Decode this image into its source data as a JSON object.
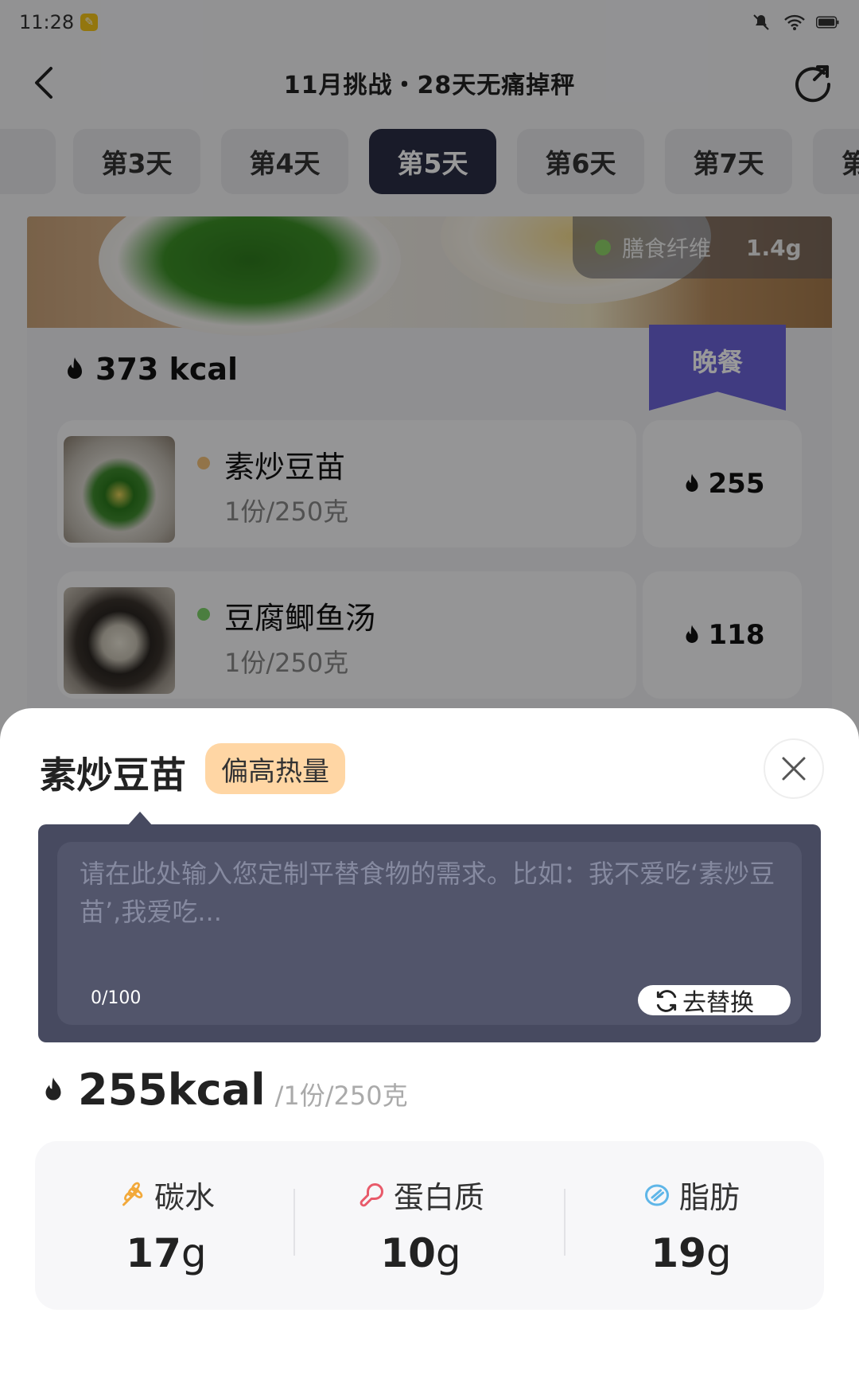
{
  "status_bar": {
    "time": "11:28"
  },
  "nav": {
    "title": "11月挑战・28天无痛掉秤"
  },
  "day_tabs": [
    "第3天",
    "第4天",
    "第5天",
    "第6天",
    "第7天",
    "第"
  ],
  "active_tab": "第5天",
  "meal": {
    "fiber_label": "膳食纤维",
    "fiber_value": "1.4g",
    "total_kcal": "373 kcal",
    "meal_label": "晚餐",
    "items": [
      {
        "name": "素炒豆苗",
        "portion": "1份/250克",
        "kcal": "255",
        "dot_color": "#f4c27a"
      },
      {
        "name": "豆腐鲫鱼汤",
        "portion": "1份/250克",
        "kcal": "118",
        "dot_color": "#7ed36a"
      }
    ]
  },
  "sheet": {
    "title": "素炒豆苗",
    "badge": "偏高热量",
    "input_placeholder": "请在此处输入您定制平替食物的需求。比如：我不爱吃‘素炒豆苗’,我爱吃...",
    "input_value": "",
    "char_count": "0/100",
    "replace_label": "去替换",
    "kcal": "255kcal",
    "portion": "/1份/250克",
    "macros": [
      {
        "label": "碳水",
        "value": "17",
        "unit": "g",
        "icon": "wheat-icon"
      },
      {
        "label": "蛋白质",
        "value": "10",
        "unit": "g",
        "icon": "drumstick-icon"
      },
      {
        "label": "脂肪",
        "value": "19",
        "unit": "g",
        "icon": "fat-drop-icon"
      }
    ]
  },
  "colors": {
    "active_tab_bg": "#2b2e45",
    "ribbon": "#6b63d8",
    "badge_bg": "#ffd6a4",
    "input_panel": "#474a60"
  }
}
